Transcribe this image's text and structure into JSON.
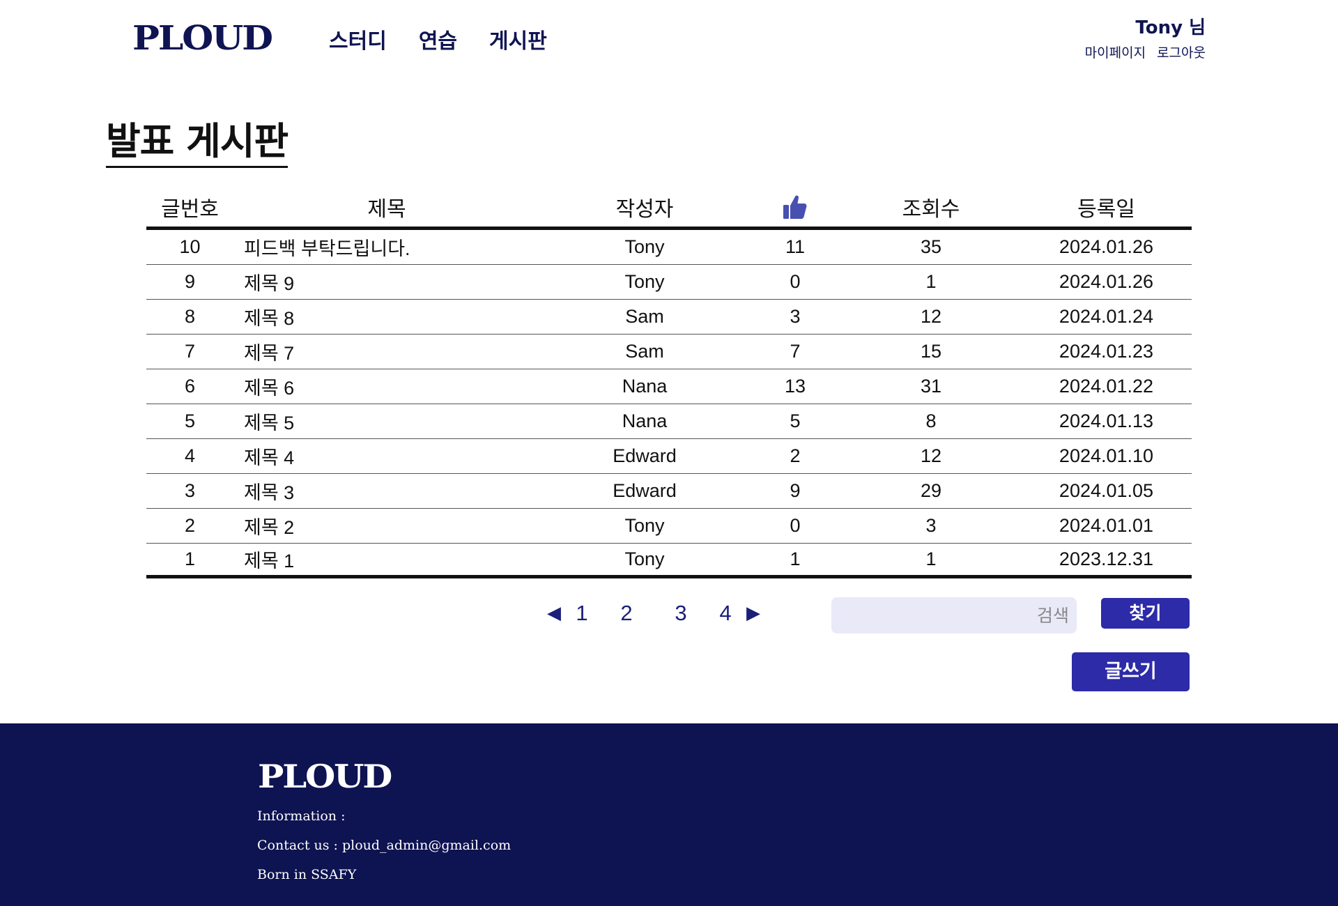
{
  "header": {
    "logo": "PLOUD",
    "nav": [
      "스터디",
      "연습",
      "게시판"
    ],
    "user_name": "Tony 님",
    "links": [
      "마이페이지",
      "로그아웃"
    ]
  },
  "page_title": "발표 게시판",
  "table": {
    "headers": [
      "글번호",
      "제목",
      "작성자",
      "조회수",
      "등록일"
    ],
    "like_icon": "thumbs-up-icon",
    "rows": [
      {
        "num": "10",
        "title": "피드백 부탁드립니다.",
        "author": "Tony",
        "likes": "11",
        "views": "35",
        "date": "2024.01.26"
      },
      {
        "num": "9",
        "title": "제목 9",
        "author": "Tony",
        "likes": "0",
        "views": "1",
        "date": "2024.01.26"
      },
      {
        "num": "8",
        "title": "제목 8",
        "author": "Sam",
        "likes": "3",
        "views": "12",
        "date": "2024.01.24"
      },
      {
        "num": "7",
        "title": "제목 7",
        "author": "Sam",
        "likes": "7",
        "views": "15",
        "date": "2024.01.23"
      },
      {
        "num": "6",
        "title": "제목 6",
        "author": "Nana",
        "likes": "13",
        "views": "31",
        "date": "2024.01.22"
      },
      {
        "num": "5",
        "title": "제목 5",
        "author": "Nana",
        "likes": "5",
        "views": "8",
        "date": "2024.01.13"
      },
      {
        "num": "4",
        "title": "제목 4",
        "author": "Edward",
        "likes": "2",
        "views": "12",
        "date": "2024.01.10"
      },
      {
        "num": "3",
        "title": "제목 3",
        "author": "Edward",
        "likes": "9",
        "views": "29",
        "date": "2024.01.05"
      },
      {
        "num": "2",
        "title": "제목 2",
        "author": "Tony",
        "likes": "0",
        "views": "3",
        "date": "2024.01.01"
      },
      {
        "num": "1",
        "title": "제목 1",
        "author": "Tony",
        "likes": "1",
        "views": "1",
        "date": "2023.12.31"
      }
    ]
  },
  "pagination": {
    "prev": "◀",
    "pages": [
      "1",
      "2",
      "3",
      "4"
    ],
    "next": "▶"
  },
  "search": {
    "placeholder": "검색",
    "button": "찾기"
  },
  "write_button": "글쓰기",
  "footer": {
    "logo": "PLOUD",
    "information": "Information :",
    "contact": "Contact us :  ploud_admin@gmail.com",
    "born": "Born in SSAFY"
  },
  "colors": {
    "brand_navy": "#0e1351",
    "button_blue": "#2d2ba8",
    "search_bg": "#e9e9f8",
    "like_icon": "#4750b0"
  }
}
